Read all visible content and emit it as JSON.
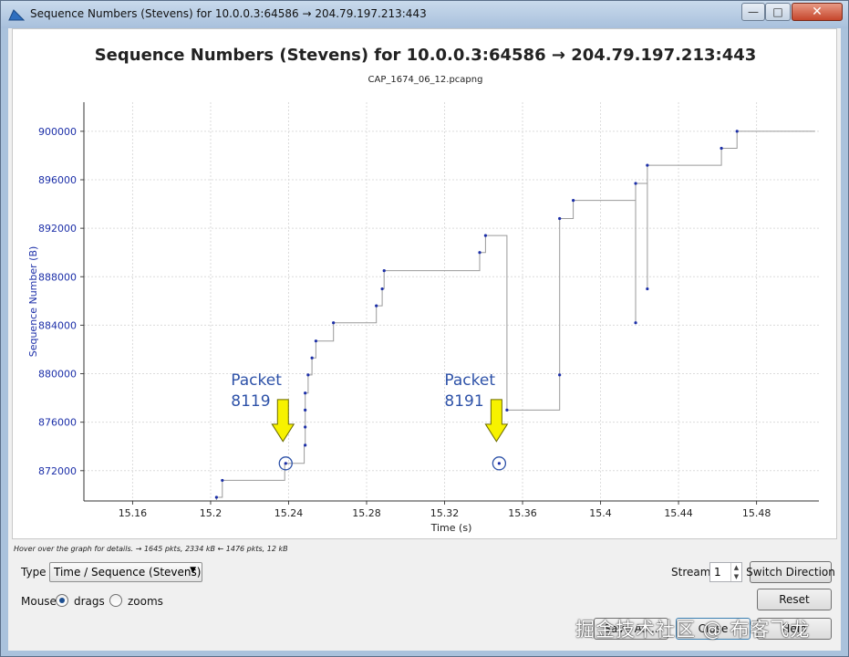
{
  "window": {
    "title": "Sequence Numbers (Stevens) for 10.0.0.3:64586 → 204.79.197.213:443",
    "minimize_glyph": "—",
    "maximize_glyph": "□",
    "close_glyph": "✕"
  },
  "chart_data": {
    "type": "scatter",
    "title": "Sequence Numbers (Stevens) for 10.0.0.3:64586 → 204.79.197.213:443",
    "subtitle": "CAP_1674_06_12.pcapng",
    "xlabel": "Time (s)",
    "ylabel": "Sequence Number (B)",
    "xlim": [
      15.135,
      15.512
    ],
    "ylim": [
      869500,
      902400
    ],
    "x_ticks": [
      "15.16",
      "15.2",
      "15.24",
      "15.28",
      "15.32",
      "15.36",
      "15.4",
      "15.44",
      "15.48"
    ],
    "y_ticks": [
      "872000",
      "876000",
      "880000",
      "884000",
      "888000",
      "892000",
      "896000",
      "900000"
    ],
    "grid": true,
    "series_color": "#1c2fa8",
    "line_color": "#9a9a9a",
    "points": [
      [
        15.203,
        869800
      ],
      [
        15.206,
        871200
      ],
      [
        15.2385,
        872600
      ],
      [
        15.2485,
        874100
      ],
      [
        15.2485,
        875600
      ],
      [
        15.2485,
        877000
      ],
      [
        15.2485,
        878400
      ],
      [
        15.25,
        879900
      ],
      [
        15.252,
        881300
      ],
      [
        15.254,
        882700
      ],
      [
        15.263,
        884200
      ],
      [
        15.285,
        885600
      ],
      [
        15.288,
        887000
      ],
      [
        15.289,
        888500
      ],
      [
        15.338,
        890000
      ],
      [
        15.341,
        891400
      ],
      [
        15.348,
        872600
      ],
      [
        15.352,
        877000
      ],
      [
        15.379,
        879900
      ],
      [
        15.379,
        892800
      ],
      [
        15.386,
        894300
      ],
      [
        15.418,
        895700
      ],
      [
        15.418,
        884200
      ],
      [
        15.424,
        897200
      ],
      [
        15.424,
        887000
      ],
      [
        15.462,
        898600
      ],
      [
        15.47,
        900000
      ]
    ],
    "step_path": [
      [
        15.203,
        869500
      ],
      [
        15.203,
        869800
      ],
      [
        15.206,
        869800
      ],
      [
        15.206,
        871200
      ],
      [
        15.238,
        871200
      ],
      [
        15.238,
        872600
      ],
      [
        15.248,
        872600
      ],
      [
        15.248,
        874100
      ],
      [
        15.2485,
        874100
      ],
      [
        15.2485,
        878400
      ],
      [
        15.25,
        878400
      ],
      [
        15.25,
        879900
      ],
      [
        15.252,
        879900
      ],
      [
        15.252,
        881300
      ],
      [
        15.254,
        881300
      ],
      [
        15.254,
        882700
      ],
      [
        15.263,
        882700
      ],
      [
        15.263,
        884200
      ],
      [
        15.285,
        884200
      ],
      [
        15.285,
        885600
      ],
      [
        15.288,
        885600
      ],
      [
        15.288,
        887000
      ],
      [
        15.289,
        887000
      ],
      [
        15.289,
        888500
      ],
      [
        15.338,
        888500
      ],
      [
        15.338,
        890000
      ],
      [
        15.341,
        890000
      ],
      [
        15.341,
        891400
      ],
      [
        15.352,
        891400
      ],
      [
        15.352,
        877000
      ],
      [
        15.379,
        877000
      ],
      [
        15.379,
        892800
      ],
      [
        15.386,
        892800
      ],
      [
        15.386,
        894300
      ],
      [
        15.418,
        894300
      ],
      [
        15.418,
        884200
      ],
      [
        15.418,
        895700
      ],
      [
        15.424,
        895700
      ],
      [
        15.424,
        887000
      ],
      [
        15.424,
        897200
      ],
      [
        15.462,
        897200
      ],
      [
        15.462,
        898600
      ],
      [
        15.47,
        898600
      ],
      [
        15.47,
        900000
      ],
      [
        15.51,
        900000
      ]
    ],
    "annotations": [
      {
        "line1": "Packet",
        "line2": "8119",
        "x": 15.2385,
        "y": 872600
      },
      {
        "line1": "Packet",
        "line2": "8191",
        "x": 15.348,
        "y": 872600
      }
    ],
    "annotation_text_color": "#2e52a8",
    "arrow_color": "#f7f200"
  },
  "status": {
    "hint": "Hover over the graph for details. → 1645 pkts, 2334 kB ← 1476 pkts, 12 kB"
  },
  "controls": {
    "type_label": "Type",
    "type_value": "Time / Sequence (Stevens)",
    "mouse_label": "Mouse",
    "drags_label": "drags",
    "zooms_label": "zooms",
    "stream_label": "Stream",
    "stream_value": "1",
    "switch_direction": "Switch Direction",
    "reset": "Reset",
    "save_as": "Save As...",
    "close": "Close",
    "help": "Help"
  },
  "watermark": "掘金技术社区 @ 布客飞龙"
}
